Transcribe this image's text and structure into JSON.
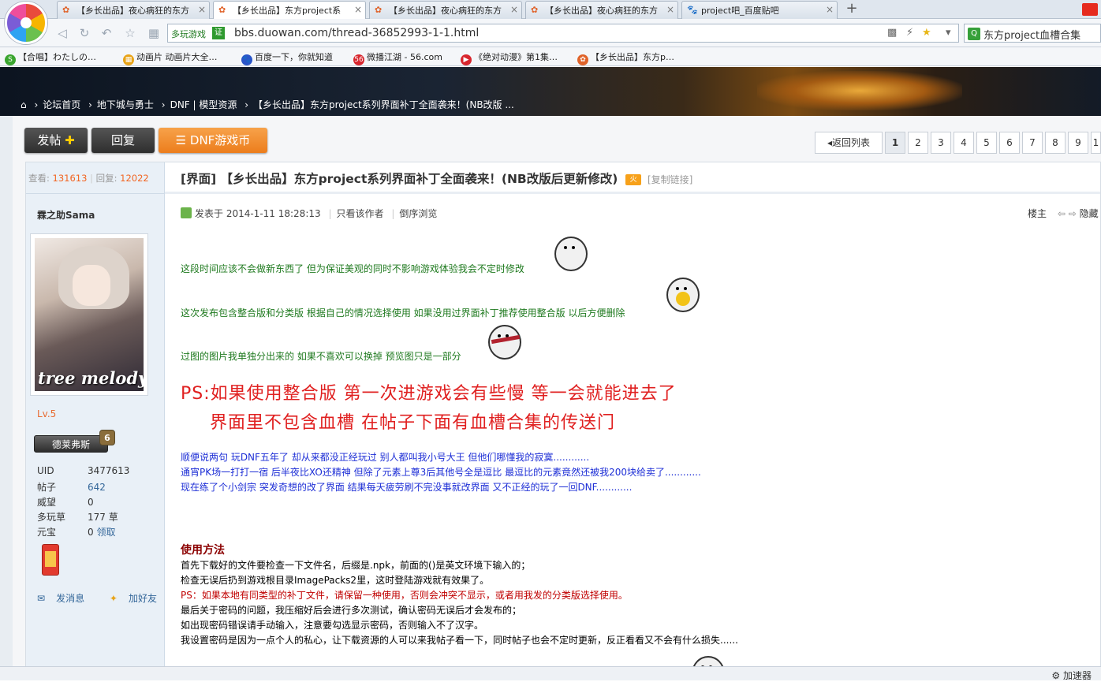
{
  "tabs": [
    {
      "title": "【乡长出品】夜心病狂的东方",
      "active": false,
      "icon": "duowan-icon"
    },
    {
      "title": "【乡长出品】东方project系",
      "active": true,
      "icon": "duowan-icon"
    },
    {
      "title": "【乡长出品】夜心病狂的东方",
      "active": false,
      "icon": "duowan-icon"
    },
    {
      "title": "【乡长出品】夜心病狂的东方",
      "active": false,
      "icon": "duowan-icon"
    },
    {
      "title": "project吧_百度贴吧",
      "active": false,
      "icon": "baidu-paw-icon"
    }
  ],
  "address": {
    "site_label": "多玩游戏",
    "cert": "证",
    "url": "bbs.duowan.com/thread-36852993-1-1.html"
  },
  "search": {
    "engine_icon": "Q",
    "text": "东方project血槽合集"
  },
  "bookmarks": [
    {
      "label": "【合唱】わたしの…",
      "icon": "S",
      "color": "#3aa52f"
    },
    {
      "label": "动画片 动画片大全…",
      "icon": "▦",
      "color": "#e8a317"
    },
    {
      "label": "百度一下，你就知道",
      "icon": "🐾",
      "color": "#2a55c9"
    },
    {
      "label": "微播江湖 - 56.com",
      "icon": "56",
      "color": "#d8262e"
    },
    {
      "label": "《绝对动漫》第1集…",
      "icon": "▶",
      "color": "#d8262e"
    },
    {
      "label": "【乡长出品】东方p…",
      "icon": "✿",
      "color": "#e0632a"
    }
  ],
  "breadcrumb": [
    "论坛首页",
    "地下城与勇士",
    "DNF | 模型资源",
    "【乡长出品】东方project系列界面补丁全面袭来！(NB改版 ..."
  ],
  "toolbar": {
    "post_label": "发帖",
    "reply_label": "回复",
    "coin_label": "DNF游戏币"
  },
  "pager": {
    "back_label": "返回列表",
    "pages": [
      "1",
      "2",
      "3",
      "4",
      "5",
      "6",
      "7",
      "8",
      "9",
      "1"
    ],
    "current": "1"
  },
  "stats": {
    "views_label": "查看:",
    "views": "131613",
    "replies_label": "回复:",
    "replies": "12022"
  },
  "user": {
    "name": "霖之助Sama",
    "avatar_text": "tree melody",
    "level": "Lv.5",
    "rank": "德莱弗斯",
    "rank_badge": "6",
    "fields": [
      {
        "key": "UID",
        "value": "3477613"
      },
      {
        "key": "帖子",
        "value": "642"
      },
      {
        "key": "威望",
        "value": "0"
      },
      {
        "key": "多玩草",
        "value": "177 草"
      },
      {
        "key": "元宝",
        "value": "0",
        "extra": "领取"
      }
    ],
    "msg_label": "发消息",
    "friend_label": "加好友"
  },
  "thread": {
    "title": "[界面] 【乡长出品】东方project系列界面补丁全面袭来！(NB改版后更新修改)",
    "hot_icon": "火",
    "copy_link": "[复制链接]",
    "posted": "发表于 2014-1-11 18:28:13",
    "only_author": "只看该作者",
    "reverse": "倒序浏览",
    "floor": "楼主",
    "hide": "隐藏"
  },
  "post": {
    "line1": "这段时间应该不会做新东西了 但为保证美观的同时不影响游戏体验我会不定时修改",
    "line2": "这次发布包含整合版和分类版 根据自己的情况选择使用 如果没用过界面补丁推荐使用整合版 以后方便删除",
    "line3": "过图的图片我单独分出来的 如果不喜欢可以换掉 预览图只是一部分",
    "ps_line1": "PS:如果使用整合版 第一次进游戏会有些慢 等一会就能进去了",
    "ps_line2": "界面里不包含血槽 在帖子下面有血槽合集的传送门",
    "blue1": "顺便说两句 玩DNF五年了 却从来都没正经玩过 别人都叫我小号大王 但他们哪懂我的寂寞............",
    "blue2": "通宵PK场一打打一宿 后半夜比XO还精神 但除了元素上尊3后其他号全是逗比 最逗比的元素竟然还被我200块给卖了............",
    "blue3": "现在练了个小剑宗 突发奇想的改了界面 结果每天疲劳刷不完没事就改界面 又不正经的玩了一回DNF............",
    "howto_title": "使用方法",
    "h1": "首先下载好的文件要检查一下文件名，后缀是.npk，前面的()是英文环境下输入的；",
    "h2": "检查无误后扔到游戏根目录ImagePacks2里，这时登陆游戏就有效果了。",
    "h3": "PS：如果本地有同类型的补丁文件，请保留一种使用，否则会冲突不显示，或者用我发的分类版选择使用。",
    "h4": "最后关于密码的问题，我压缩好后会进行多次测试，确认密码无误后才会发布的；",
    "h5": "如出现密码错误请手动输入，注意要勾选显示密码，否则输入不了汉字。",
    "h6": "我设置密码是因为一点个人的私心，让下载资源的人可以来我帖子看一下，同时帖子也会不定时更新，反正看看又不会有什么损失......"
  },
  "status": {
    "accel": "加速器"
  }
}
